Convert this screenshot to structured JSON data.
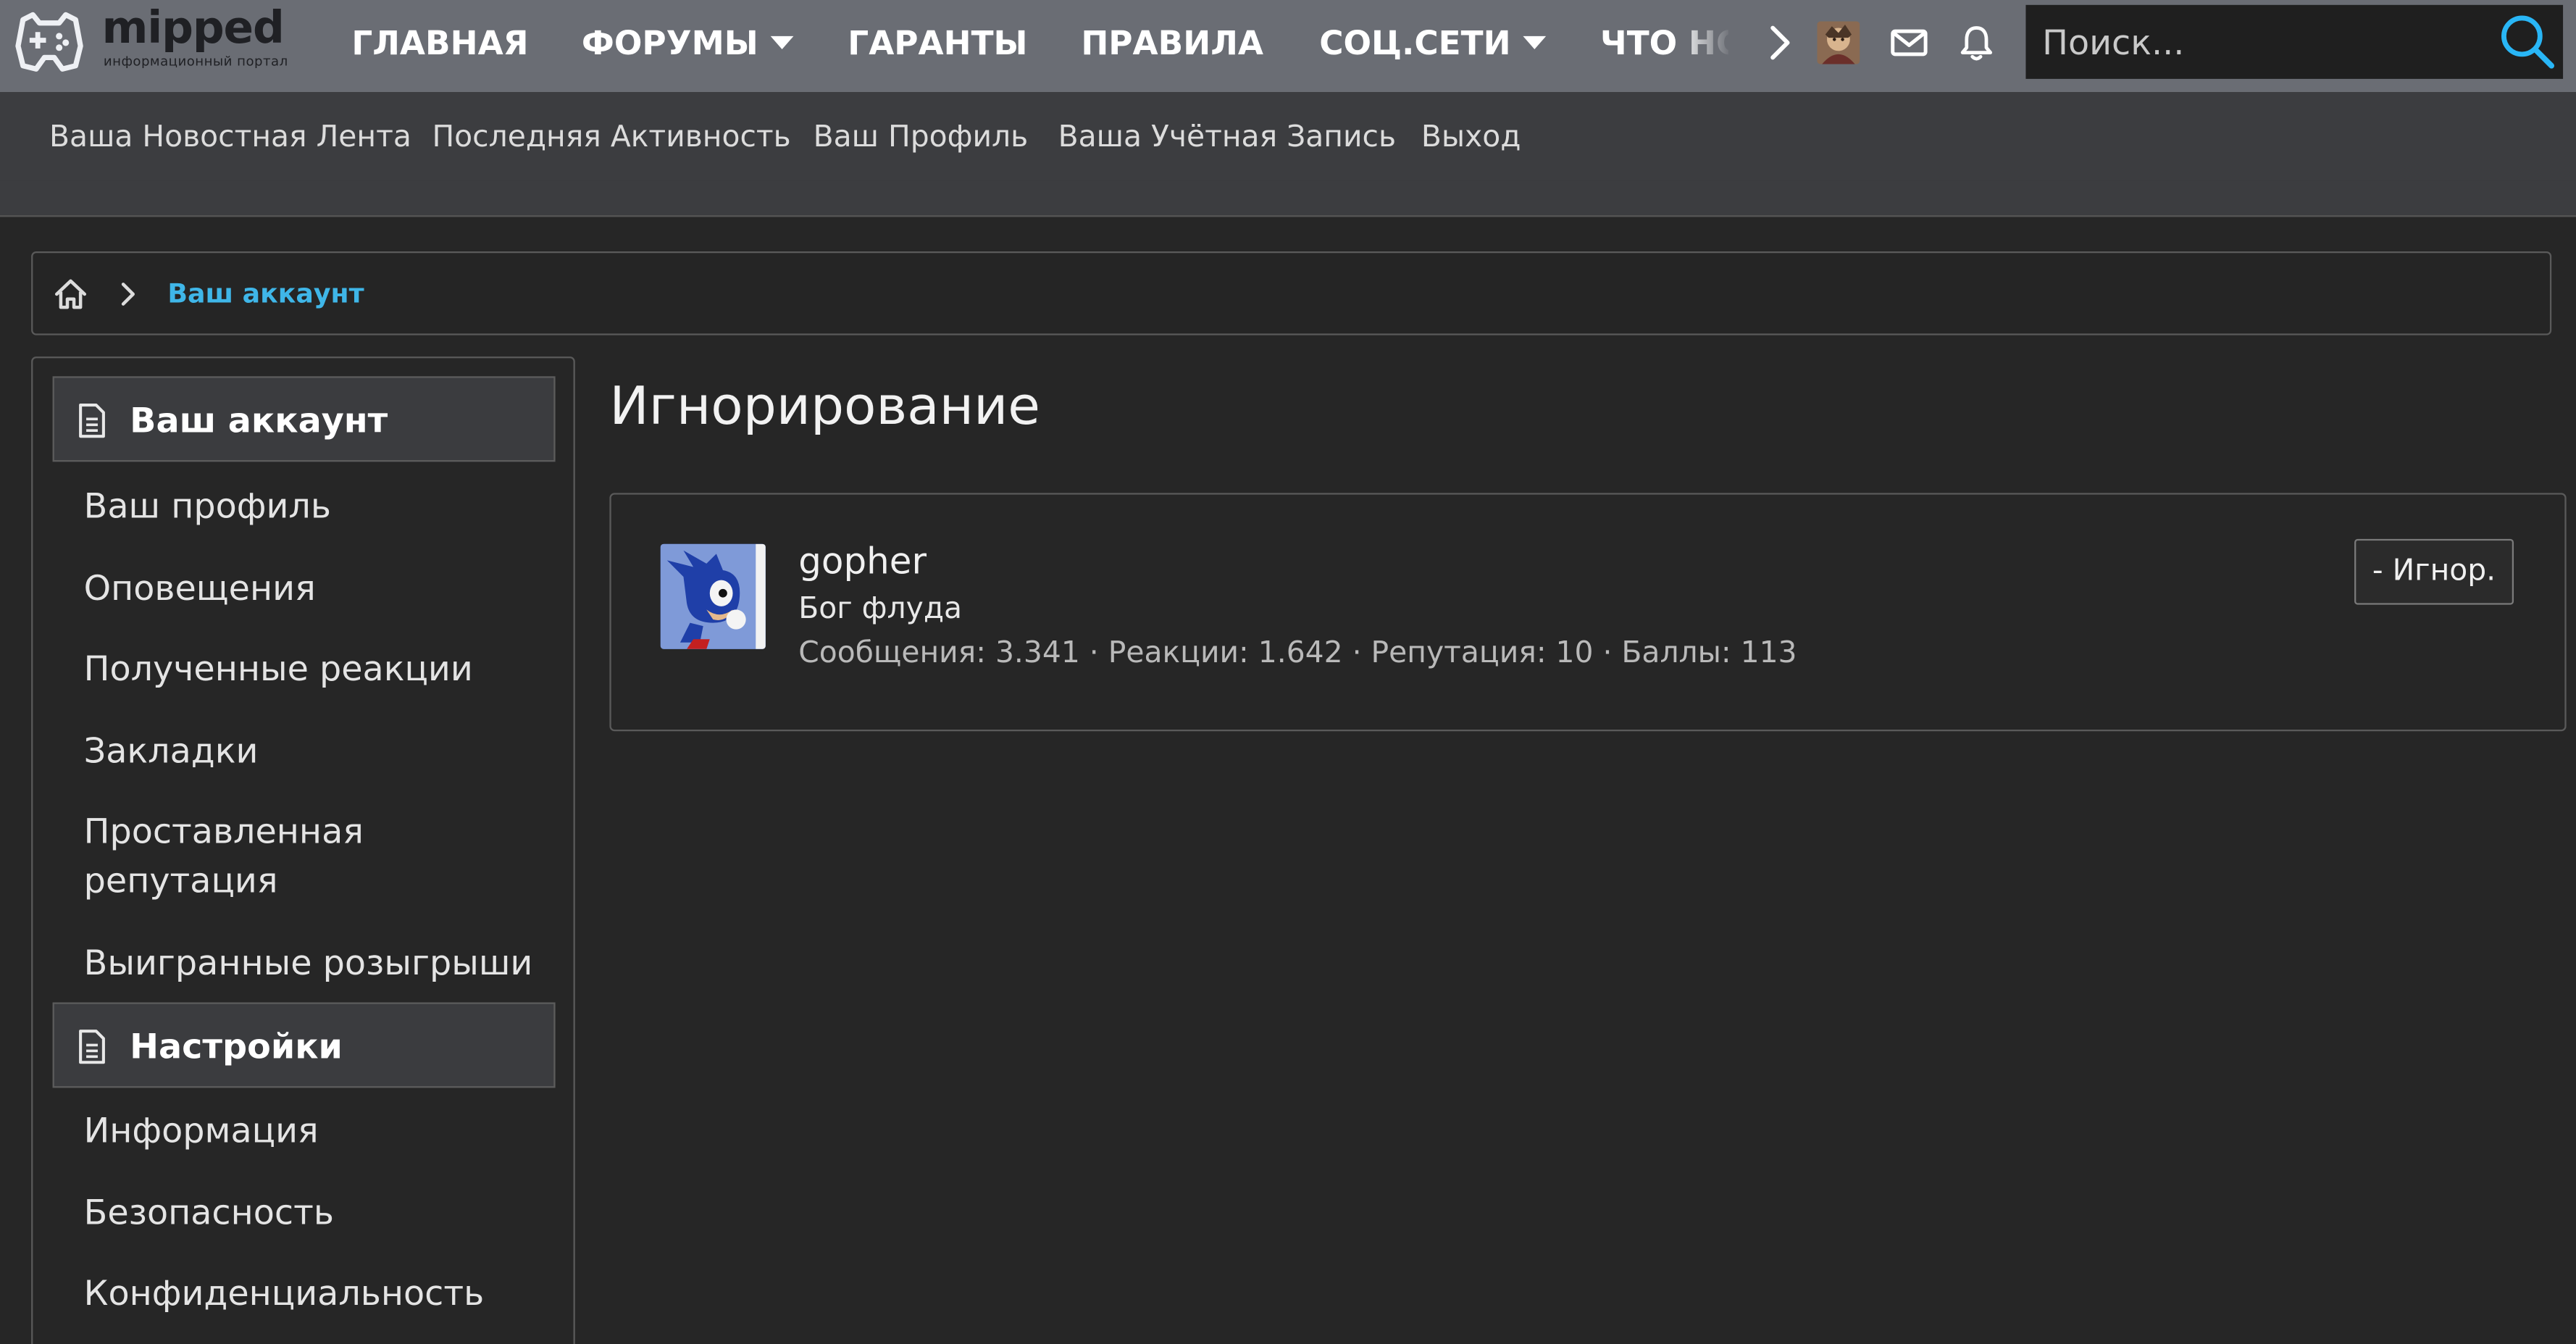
{
  "header": {
    "brand_name": "mipped",
    "brand_tagline": "информационный портал",
    "nav": [
      {
        "label": "ГЛАВНАЯ"
      },
      {
        "label": "ФОРУМЫ"
      },
      {
        "label": "ГАРАНТЫ"
      },
      {
        "label": "ПРАВИЛА"
      },
      {
        "label": "СОЦ.СЕТИ"
      },
      {
        "label": "ЧТО НОВОГО"
      }
    ],
    "search_placeholder": "Поиск..."
  },
  "subnav": [
    {
      "label": "Ваша Новостная Лента"
    },
    {
      "label": "Последняя Активность"
    },
    {
      "label": "Ваш Профиль"
    },
    {
      "label": "Ваша Учётная Запись"
    },
    {
      "label": "Выход"
    }
  ],
  "breadcrumb": {
    "current": "Ваш аккаунт"
  },
  "sidebar": {
    "section1": "Ваш аккаунт",
    "items1": [
      "Ваш профиль",
      "Оповещения",
      "Полученные реакции",
      "Закладки",
      "Проставленная репутация",
      "Выигранные розыгрыши"
    ],
    "section2": "Настройки",
    "items2": [
      "Информация",
      "Безопасность",
      "Конфиденциальность"
    ]
  },
  "main": {
    "title": "Игнорирование",
    "user": {
      "name": "gopher",
      "title": "Бог флуда",
      "stats": "Сообщения: 3.341 · Реакции: 1.642 · Репутация: 10 · Баллы: 113",
      "unignore_label": "- Игнор."
    }
  },
  "colors": {
    "topbar": "#6a6d74",
    "subbar": "#3c3d40",
    "background": "#262626",
    "accent_link": "#3fb6e8",
    "search_icon": "#29b6f6"
  },
  "icons": [
    "gamepad-logo-icon",
    "caret-down-icon",
    "chevron-right-icon",
    "envelope-icon",
    "bell-icon",
    "search-icon",
    "home-icon",
    "document-icon"
  ]
}
